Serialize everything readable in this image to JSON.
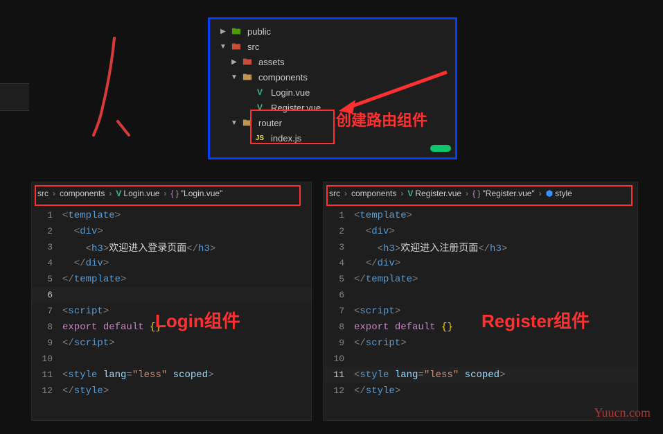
{
  "explorer": {
    "items": [
      {
        "depth": 0,
        "chevron": "right",
        "icon": "folder-green",
        "label": "public"
      },
      {
        "depth": 0,
        "chevron": "down",
        "icon": "folder-red",
        "label": "src"
      },
      {
        "depth": 1,
        "chevron": "right",
        "icon": "folder-red",
        "label": "assets"
      },
      {
        "depth": 1,
        "chevron": "down",
        "icon": "folder-yellow",
        "label": "components"
      },
      {
        "depth": 2,
        "chevron": "",
        "icon": "vue",
        "label": "Login.vue"
      },
      {
        "depth": 2,
        "chevron": "",
        "icon": "vue",
        "label": "Register.vue"
      },
      {
        "depth": 1,
        "chevron": "down",
        "icon": "folder-yellow",
        "label": "router"
      },
      {
        "depth": 2,
        "chevron": "",
        "icon": "js",
        "label": "index.js"
      }
    ],
    "annotation": "创建路由组件"
  },
  "left": {
    "crumbs": [
      "src",
      "components",
      "Login.vue",
      "\"Login.vue\""
    ],
    "label": "Login组件",
    "code": [
      {
        "n": 1,
        "html": "<span class='punct'>&lt;</span><span class='tag'>template</span><span class='punct'>&gt;</span>"
      },
      {
        "n": 2,
        "html": "  <span class='punct'>&lt;</span><span class='tag'>div</span><span class='punct'>&gt;</span>"
      },
      {
        "n": 3,
        "html": "    <span class='punct'>&lt;</span><span class='tag'>h3</span><span class='punct'>&gt;</span><span class='txt'>欢迎进入登录页面</span><span class='punct'>&lt;/</span><span class='tag'>h3</span><span class='punct'>&gt;</span>"
      },
      {
        "n": 4,
        "html": "  <span class='punct'>&lt;/</span><span class='tag'>div</span><span class='punct'>&gt;</span>"
      },
      {
        "n": 5,
        "html": "<span class='punct'>&lt;/</span><span class='tag'>template</span><span class='punct'>&gt;</span>"
      },
      {
        "n": 6,
        "html": "",
        "active": true
      },
      {
        "n": 7,
        "html": "<span class='punct'>&lt;</span><span class='tag'>script</span><span class='punct'>&gt;</span>"
      },
      {
        "n": 8,
        "html": "<span class='kw-teal'>export</span> <span class='kw-teal'>default</span> <span class='curly'>{}</span>"
      },
      {
        "n": 9,
        "html": "<span class='punct'>&lt;/</span><span class='tag'>script</span><span class='punct'>&gt;</span>"
      },
      {
        "n": 10,
        "html": ""
      },
      {
        "n": 11,
        "html": "<span class='punct'>&lt;</span><span class='tag'>style</span> <span class='attr'>lang</span><span class='punct'>=</span><span class='str'>\"less\"</span> <span class='attr'>scoped</span><span class='punct'>&gt;</span>"
      },
      {
        "n": 12,
        "html": "<span class='punct'>&lt;/</span><span class='tag'>style</span><span class='punct'>&gt;</span>"
      }
    ]
  },
  "right": {
    "crumbs": [
      "src",
      "components",
      "Register.vue",
      "\"Register.vue\"",
      "style"
    ],
    "label": "Register组件",
    "code": [
      {
        "n": 1,
        "html": "<span class='punct'>&lt;</span><span class='tag'>template</span><span class='punct'>&gt;</span>"
      },
      {
        "n": 2,
        "html": "  <span class='punct'>&lt;</span><span class='tag'>div</span><span class='punct'>&gt;</span>"
      },
      {
        "n": 3,
        "html": "    <span class='punct'>&lt;</span><span class='tag'>h3</span><span class='punct'>&gt;</span><span class='txt'>欢迎进入注册页面</span><span class='punct'>&lt;/</span><span class='tag'>h3</span><span class='punct'>&gt;</span>"
      },
      {
        "n": 4,
        "html": "  <span class='punct'>&lt;/</span><span class='tag'>div</span><span class='punct'>&gt;</span>"
      },
      {
        "n": 5,
        "html": "<span class='punct'>&lt;/</span><span class='tag'>template</span><span class='punct'>&gt;</span>"
      },
      {
        "n": 6,
        "html": ""
      },
      {
        "n": 7,
        "html": "<span class='punct'>&lt;</span><span class='tag'>script</span><span class='punct'>&gt;</span>"
      },
      {
        "n": 8,
        "html": "<span class='kw-teal'>export</span> <span class='kw-teal'>default</span> <span class='curly'>{}</span>"
      },
      {
        "n": 9,
        "html": "<span class='punct'>&lt;/</span><span class='tag'>script</span><span class='punct'>&gt;</span>"
      },
      {
        "n": 10,
        "html": ""
      },
      {
        "n": 11,
        "html": "<span class='punct'>&lt;</span><span class='tag'>style</span> <span class='attr'>lang</span><span class='punct'>=</span><span class='str'>\"less\"</span> <span class='attr'>scoped</span><span class='punct'>&gt;</span>",
        "active": true
      },
      {
        "n": 12,
        "html": "<span class='punct'>&lt;/</span><span class='tag'>style</span><span class='punct'>&gt;</span>"
      }
    ]
  },
  "watermark": "Yuucn.com"
}
